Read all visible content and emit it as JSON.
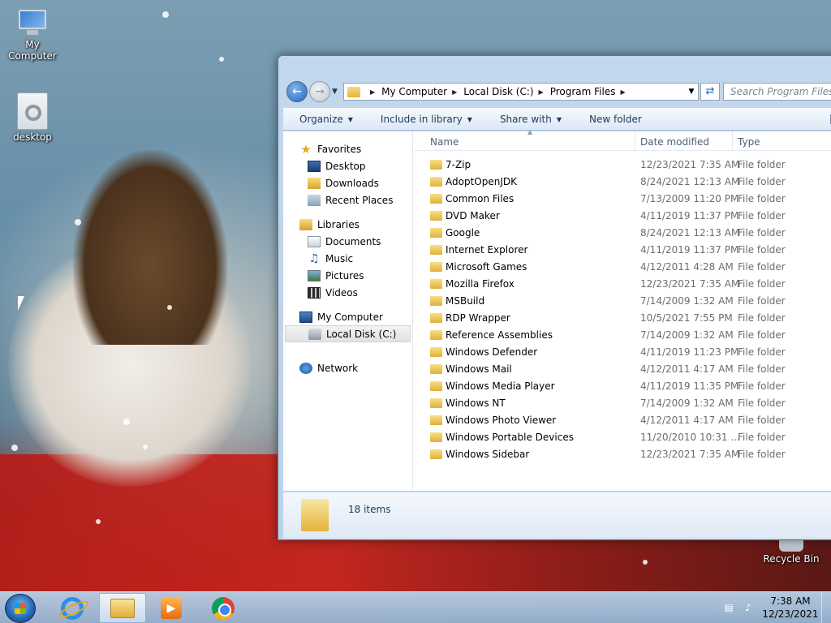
{
  "desktop": {
    "icons": [
      {
        "label": "My Computer",
        "icon": "my-computer-icon"
      },
      {
        "label": "desktop",
        "icon": "file-icon"
      },
      {
        "label": "Recycle Bin",
        "icon": "recycle-bin-icon"
      }
    ]
  },
  "explorer": {
    "breadcrumb": [
      "My Computer",
      "Local Disk (C:)",
      "Program Files"
    ],
    "search_placeholder": "Search Program Files",
    "toolbar": {
      "organize": "Organize",
      "include_in_library": "Include in library",
      "share_with": "Share with",
      "new_folder": "New folder"
    },
    "nav": {
      "favorites": "Favorites",
      "favorites_items": [
        "Desktop",
        "Downloads",
        "Recent Places"
      ],
      "libraries": "Libraries",
      "libraries_items": [
        "Documents",
        "Music",
        "Pictures",
        "Videos"
      ],
      "computer": "My Computer",
      "computer_items": [
        "Local Disk (C:)"
      ],
      "network": "Network"
    },
    "columns": {
      "name": "Name",
      "date": "Date modified",
      "type": "Type"
    },
    "files": [
      {
        "name": "7-Zip",
        "date": "12/23/2021 7:35 AM",
        "type": "File folder"
      },
      {
        "name": "AdoptOpenJDK",
        "date": "8/24/2021 12:13 AM",
        "type": "File folder"
      },
      {
        "name": "Common Files",
        "date": "7/13/2009 11:20 PM",
        "type": "File folder"
      },
      {
        "name": "DVD Maker",
        "date": "4/11/2019 11:37 PM",
        "type": "File folder"
      },
      {
        "name": "Google",
        "date": "8/24/2021 12:13 AM",
        "type": "File folder"
      },
      {
        "name": "Internet Explorer",
        "date": "4/11/2019 11:37 PM",
        "type": "File folder"
      },
      {
        "name": "Microsoft Games",
        "date": "4/12/2011 4:28 AM",
        "type": "File folder"
      },
      {
        "name": "Mozilla Firefox",
        "date": "12/23/2021 7:35 AM",
        "type": "File folder"
      },
      {
        "name": "MSBuild",
        "date": "7/14/2009 1:32 AM",
        "type": "File folder"
      },
      {
        "name": "RDP Wrapper",
        "date": "10/5/2021 7:55 PM",
        "type": "File folder"
      },
      {
        "name": "Reference Assemblies",
        "date": "7/14/2009 1:32 AM",
        "type": "File folder"
      },
      {
        "name": "Windows Defender",
        "date": "4/11/2019 11:23 PM",
        "type": "File folder"
      },
      {
        "name": "Windows Mail",
        "date": "4/12/2011 4:17 AM",
        "type": "File folder"
      },
      {
        "name": "Windows Media Player",
        "date": "4/11/2019 11:35 PM",
        "type": "File folder"
      },
      {
        "name": "Windows NT",
        "date": "7/14/2009 1:32 AM",
        "type": "File folder"
      },
      {
        "name": "Windows Photo Viewer",
        "date": "4/12/2011 4:17 AM",
        "type": "File folder"
      },
      {
        "name": "Windows Portable Devices",
        "date": "11/20/2010 10:31 ...",
        "type": "File folder"
      },
      {
        "name": "Windows Sidebar",
        "date": "12/23/2021 7:35 AM",
        "type": "File folder"
      }
    ],
    "status": "18 items"
  },
  "taskbar": {
    "apps": [
      "internet-explorer-icon",
      "windows-explorer-icon",
      "media-player-icon",
      "chrome-icon"
    ],
    "time": "7:38 AM",
    "date": "12/23/2021"
  }
}
